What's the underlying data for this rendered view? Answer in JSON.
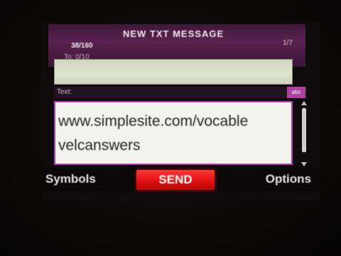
{
  "header": {
    "title": "NEW TXT MESSAGE",
    "char_counter": "38/160",
    "page_indicator": "1/7"
  },
  "recipients": {
    "label": "To: 0/10",
    "value": ""
  },
  "message": {
    "label": "Text:",
    "input_mode": "abc",
    "content": "www.simplesite.com/vocable\nvelcanswers"
  },
  "softkeys": {
    "left": "Symbols",
    "center": "SEND",
    "right": "Options"
  },
  "colors": {
    "accent": "#b83aa8",
    "send_button": "#e01010",
    "field_background": "#dfe4cf"
  }
}
